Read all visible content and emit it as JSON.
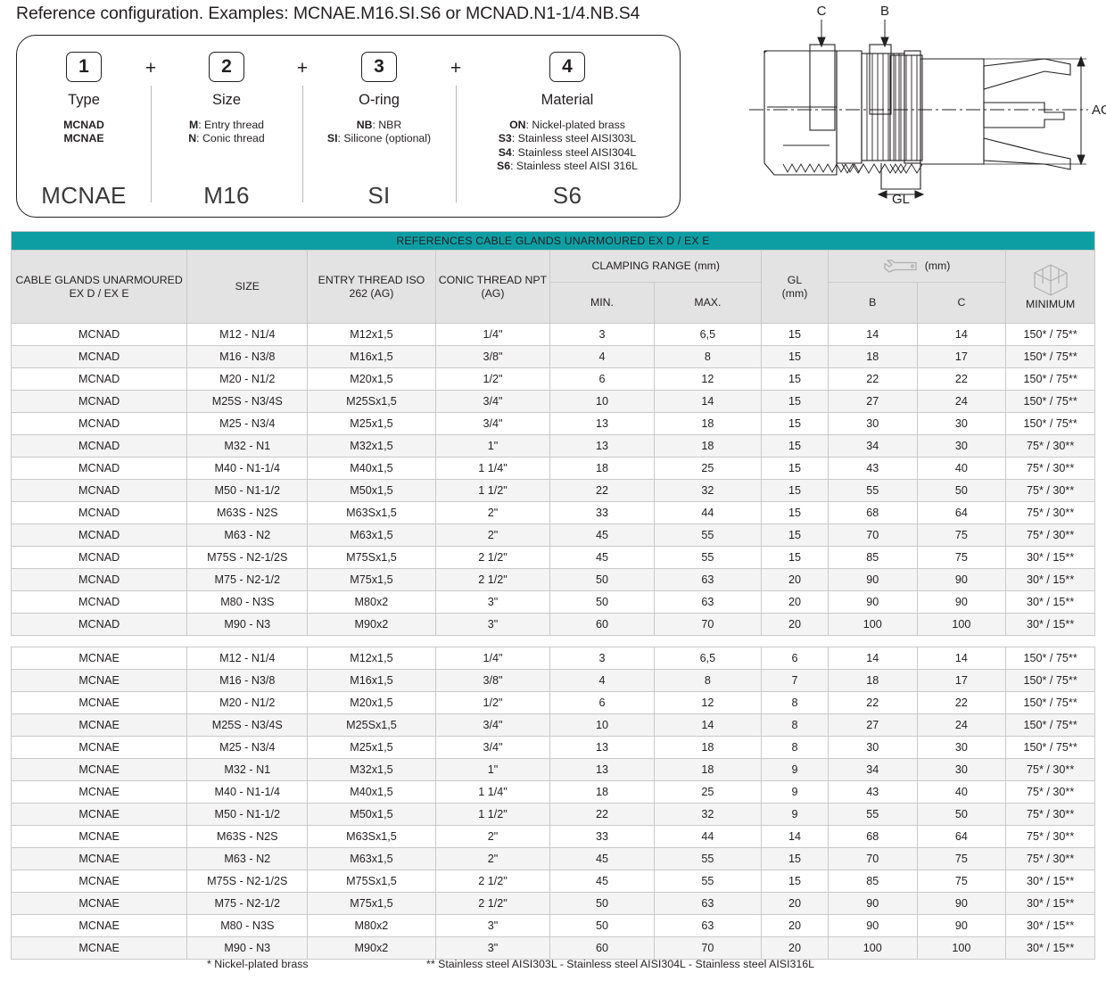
{
  "title": "Reference configuration. Examples: MCNAE.M16.SI.S6 or MCNAD.N1-1/4.NB.S4",
  "config": {
    "plus": "+",
    "columns": [
      {
        "number": "1",
        "heading": "Type",
        "lines": [
          "MCNAD",
          "MCNAE"
        ],
        "example": "MCNAE"
      },
      {
        "number": "2",
        "heading": "Size",
        "lines": [
          "M: Entry thread",
          "N: Conic thread"
        ],
        "example": "M16"
      },
      {
        "number": "3",
        "heading": "O-ring",
        "lines": [
          "NB: NBR",
          "SI: Silicone (optional)"
        ],
        "example": "SI"
      },
      {
        "number": "4",
        "heading": "Material",
        "lines": [
          "ON: Nickel-plated brass",
          "S3: Stainless steel AISI303L",
          "S4: Stainless steel AISI304L",
          "S6: Stainless steel AISI 316L"
        ],
        "example": "S6"
      }
    ]
  },
  "drawing": {
    "label_c": "C",
    "label_b": "B",
    "label_ag": "AG",
    "label_gl": "GL"
  },
  "table": {
    "banner": "REFERENCES CABLE GLANDS UNARMOURED EX D / EX E",
    "headers": {
      "type": "CABLE GLANDS UNARMOURED EX D / EX E",
      "size": "SIZE",
      "entry_thread": "ENTRY THREAD ISO 262 (AG)",
      "conic_thread": "CONIC THREAD NPT (AG)",
      "clamping_range": "CLAMPING RANGE (mm)",
      "min": "MIN.",
      "max": "MAX.",
      "gl": "GL",
      "gl_unit": "(mm)",
      "wrench_unit": "(mm)",
      "b": "B",
      "c": "C",
      "minimum": "MINIMUM"
    },
    "icons": {
      "wrench": "wrench-icon",
      "box": "box-icon"
    }
  },
  "footnotes": {
    "single_star": "* Nickel-plated brass",
    "double_star": "** Stainless steel AISI303L - Stainless steel AISI304L - Stainless steel AISI316L"
  },
  "chart_data": {
    "type": "table",
    "title": "REFERENCES CABLE GLANDS UNARMOURED EX D / EX E",
    "columns": [
      "CABLE GLANDS UNARMOURED EX D / EX E",
      "SIZE",
      "ENTRY THREAD ISO 262 (AG)",
      "CONIC THREAD NPT (AG)",
      "CLAMPING RANGE (mm) MIN.",
      "CLAMPING RANGE (mm) MAX.",
      "GL (mm)",
      "B (mm)",
      "C (mm)",
      "MINIMUM"
    ],
    "sections": [
      {
        "name": "MCNAD",
        "rows": [
          [
            "MCNAD",
            "M12 - N1/4",
            "M12x1,5",
            "1/4\"",
            "3",
            "6,5",
            "15",
            "14",
            "14",
            "150* / 75**"
          ],
          [
            "MCNAD",
            "M16 - N3/8",
            "M16x1,5",
            "3/8\"",
            "4",
            "8",
            "15",
            "18",
            "17",
            "150* / 75**"
          ],
          [
            "MCNAD",
            "M20 - N1/2",
            "M20x1,5",
            "1/2\"",
            "6",
            "12",
            "15",
            "22",
            "22",
            "150* / 75**"
          ],
          [
            "MCNAD",
            "M25S - N3/4S",
            "M25Sx1,5",
            "3/4\"",
            "10",
            "14",
            "15",
            "27",
            "24",
            "150* / 75**"
          ],
          [
            "MCNAD",
            "M25 - N3/4",
            "M25x1,5",
            "3/4\"",
            "13",
            "18",
            "15",
            "30",
            "30",
            "150* / 75**"
          ],
          [
            "MCNAD",
            "M32 - N1",
            "M32x1,5",
            "1\"",
            "13",
            "18",
            "15",
            "34",
            "30",
            "75* / 30**"
          ],
          [
            "MCNAD",
            "M40 - N1-1/4",
            "M40x1,5",
            "1 1/4\"",
            "18",
            "25",
            "15",
            "43",
            "40",
            "75* / 30**"
          ],
          [
            "MCNAD",
            "M50 - N1-1/2",
            "M50x1,5",
            "1 1/2\"",
            "22",
            "32",
            "15",
            "55",
            "50",
            "75* / 30**"
          ],
          [
            "MCNAD",
            "M63S - N2S",
            "M63Sx1,5",
            "2\"",
            "33",
            "44",
            "15",
            "68",
            "64",
            "75* / 30**"
          ],
          [
            "MCNAD",
            "M63 - N2",
            "M63x1,5",
            "2\"",
            "45",
            "55",
            "15",
            "70",
            "75",
            "75* / 30**"
          ],
          [
            "MCNAD",
            "M75S - N2-1/2S",
            "M75Sx1,5",
            "2 1/2\"",
            "45",
            "55",
            "15",
            "85",
            "75",
            "30* / 15**"
          ],
          [
            "MCNAD",
            "M75 - N2-1/2",
            "M75x1,5",
            "2 1/2\"",
            "50",
            "63",
            "20",
            "90",
            "90",
            "30* / 15**"
          ],
          [
            "MCNAD",
            "M80 - N3S",
            "M80x2",
            "3\"",
            "50",
            "63",
            "20",
            "90",
            "90",
            "30* / 15**"
          ],
          [
            "MCNAD",
            "M90 - N3",
            "M90x2",
            "3\"",
            "60",
            "70",
            "20",
            "100",
            "100",
            "30* / 15**"
          ]
        ]
      },
      {
        "name": "MCNAE",
        "rows": [
          [
            "MCNAE",
            "M12 - N1/4",
            "M12x1,5",
            "1/4\"",
            "3",
            "6,5",
            "6",
            "14",
            "14",
            "150* / 75**"
          ],
          [
            "MCNAE",
            "M16 - N3/8",
            "M16x1,5",
            "3/8\"",
            "4",
            "8",
            "7",
            "18",
            "17",
            "150* / 75**"
          ],
          [
            "MCNAE",
            "M20 - N1/2",
            "M20x1,5",
            "1/2\"",
            "6",
            "12",
            "8",
            "22",
            "22",
            "150* / 75**"
          ],
          [
            "MCNAE",
            "M25S - N3/4S",
            "M25Sx1,5",
            "3/4\"",
            "10",
            "14",
            "8",
            "27",
            "24",
            "150* / 75**"
          ],
          [
            "MCNAE",
            "M25 - N3/4",
            "M25x1,5",
            "3/4\"",
            "13",
            "18",
            "8",
            "30",
            "30",
            "150* / 75**"
          ],
          [
            "MCNAE",
            "M32 - N1",
            "M32x1,5",
            "1\"",
            "13",
            "18",
            "9",
            "34",
            "30",
            "75* / 30**"
          ],
          [
            "MCNAE",
            "M40 - N1-1/4",
            "M40x1,5",
            "1 1/4\"",
            "18",
            "25",
            "9",
            "43",
            "40",
            "75* / 30**"
          ],
          [
            "MCNAE",
            "M50 - N1-1/2",
            "M50x1,5",
            "1 1/2\"",
            "22",
            "32",
            "9",
            "55",
            "50",
            "75* / 30**"
          ],
          [
            "MCNAE",
            "M63S - N2S",
            "M63Sx1,5",
            "2\"",
            "33",
            "44",
            "14",
            "68",
            "64",
            "75* / 30**"
          ],
          [
            "MCNAE",
            "M63 - N2",
            "M63x1,5",
            "2\"",
            "45",
            "55",
            "15",
            "70",
            "75",
            "75* / 30**"
          ],
          [
            "MCNAE",
            "M75S - N2-1/2S",
            "M75Sx1,5",
            "2 1/2\"",
            "45",
            "55",
            "15",
            "85",
            "75",
            "30* / 15**"
          ],
          [
            "MCNAE",
            "M75 - N2-1/2",
            "M75x1,5",
            "2 1/2\"",
            "50",
            "63",
            "20",
            "90",
            "90",
            "30* / 15**"
          ],
          [
            "MCNAE",
            "M80 - N3S",
            "M80x2",
            "3\"",
            "50",
            "63",
            "20",
            "90",
            "90",
            "30* / 15**"
          ],
          [
            "MCNAE",
            "M90 - N3",
            "M90x2",
            "3\"",
            "60",
            "70",
            "20",
            "100",
            "100",
            "30* / 15**"
          ]
        ]
      }
    ]
  }
}
